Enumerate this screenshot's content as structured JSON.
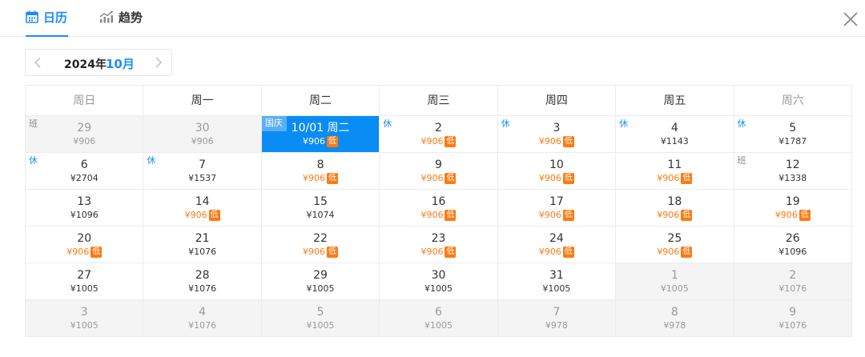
{
  "tabs": [
    {
      "label": "日历",
      "active": true,
      "icon": "calendar-icon"
    },
    {
      "label": "趋势",
      "active": false,
      "icon": "trend-icon"
    }
  ],
  "nav": {
    "year": "2024年",
    "month": "10月"
  },
  "colors": {
    "accent": "#1a8cff",
    "low": "#ff7a12",
    "selected": "#0a8cf5"
  },
  "calendar": {
    "weekdays": [
      "周日",
      "周一",
      "周二",
      "周三",
      "周四",
      "周五",
      "周六"
    ],
    "weekend_cols": [
      0,
      6
    ],
    "low_badge": "低",
    "weeks": [
      [
        {
          "day": "29",
          "price": "¥906",
          "other": true,
          "tag": "班",
          "tag_type": "work"
        },
        {
          "day": "30",
          "price": "¥906",
          "other": true
        },
        {
          "day": "10/01 周二",
          "price": "¥906",
          "low": true,
          "tag": "国庆",
          "tag_type": "rest",
          "selected": true
        },
        {
          "day": "2",
          "price": "¥906",
          "low": true,
          "tag": "休",
          "tag_type": "rest"
        },
        {
          "day": "3",
          "price": "¥906",
          "low": true,
          "tag": "休",
          "tag_type": "rest"
        },
        {
          "day": "4",
          "price": "¥1143",
          "tag": "休",
          "tag_type": "rest"
        },
        {
          "day": "5",
          "price": "¥1787",
          "tag": "休",
          "tag_type": "rest"
        }
      ],
      [
        {
          "day": "6",
          "price": "¥2704",
          "tag": "休",
          "tag_type": "rest"
        },
        {
          "day": "7",
          "price": "¥1537",
          "tag": "休",
          "tag_type": "rest"
        },
        {
          "day": "8",
          "price": "¥906",
          "low": true
        },
        {
          "day": "9",
          "price": "¥906",
          "low": true
        },
        {
          "day": "10",
          "price": "¥906",
          "low": true
        },
        {
          "day": "11",
          "price": "¥906",
          "low": true
        },
        {
          "day": "12",
          "price": "¥1338",
          "tag": "班",
          "tag_type": "work"
        }
      ],
      [
        {
          "day": "13",
          "price": "¥1096"
        },
        {
          "day": "14",
          "price": "¥906",
          "low": true
        },
        {
          "day": "15",
          "price": "¥1074"
        },
        {
          "day": "16",
          "price": "¥906",
          "low": true
        },
        {
          "day": "17",
          "price": "¥906",
          "low": true
        },
        {
          "day": "18",
          "price": "¥906",
          "low": true
        },
        {
          "day": "19",
          "price": "¥906",
          "low": true
        }
      ],
      [
        {
          "day": "20",
          "price": "¥906",
          "low": true
        },
        {
          "day": "21",
          "price": "¥1076"
        },
        {
          "day": "22",
          "price": "¥906",
          "low": true
        },
        {
          "day": "23",
          "price": "¥906",
          "low": true
        },
        {
          "day": "24",
          "price": "¥906",
          "low": true
        },
        {
          "day": "25",
          "price": "¥906",
          "low": true
        },
        {
          "day": "26",
          "price": "¥1096"
        }
      ],
      [
        {
          "day": "27",
          "price": "¥1005"
        },
        {
          "day": "28",
          "price": "¥1076"
        },
        {
          "day": "29",
          "price": "¥1005"
        },
        {
          "day": "30",
          "price": "¥1005"
        },
        {
          "day": "31",
          "price": "¥1005"
        },
        {
          "day": "1",
          "price": "¥1005",
          "other": true
        },
        {
          "day": "2",
          "price": "¥1076",
          "other": true
        }
      ],
      [
        {
          "day": "3",
          "price": "¥1005",
          "other": true
        },
        {
          "day": "4",
          "price": "¥1076",
          "other": true
        },
        {
          "day": "5",
          "price": "¥1005",
          "other": true
        },
        {
          "day": "6",
          "price": "¥1005",
          "other": true
        },
        {
          "day": "7",
          "price": "¥978",
          "other": true
        },
        {
          "day": "8",
          "price": "¥978",
          "other": true
        },
        {
          "day": "9",
          "price": "¥1076",
          "other": true
        }
      ]
    ]
  }
}
